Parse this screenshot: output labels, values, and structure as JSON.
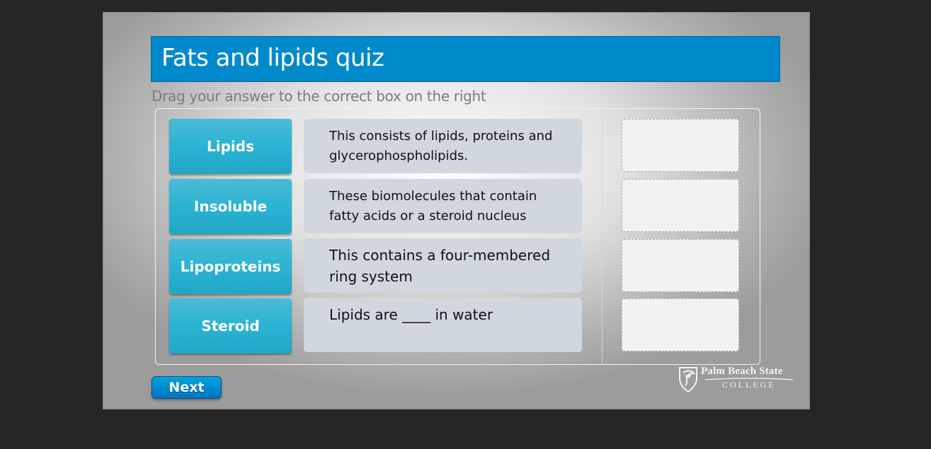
{
  "quiz": {
    "title": "Fats and lipids quiz",
    "instruction": "Drag your answer to the correct box on the right"
  },
  "answers": [
    {
      "label": "Lipids"
    },
    {
      "label": "Insoluble"
    },
    {
      "label": "Lipoproteins"
    },
    {
      "label": "Steroid"
    }
  ],
  "questions": [
    {
      "text": "This consists of lipids, proteins and glycerophospholipids."
    },
    {
      "text": "These biomolecules that contain fatty acids or a steroid nucleus"
    },
    {
      "text": "This contains a four-membered ring system"
    },
    {
      "text": "Lipids are ____ in water"
    }
  ],
  "drop_targets": [
    {
      "value": ""
    },
    {
      "value": ""
    },
    {
      "value": ""
    },
    {
      "value": ""
    }
  ],
  "navigation": {
    "next_label": "Next"
  },
  "branding": {
    "name_line1": "Palm Beach State",
    "name_line2": "COLLEGE",
    "logo_icon": "shield-pelican-icon"
  },
  "colors": {
    "title_bar": "#0089cb",
    "answer_tile": "#2bb3d4",
    "question_box": "#d1d7df",
    "next_button": "#0086d0"
  }
}
